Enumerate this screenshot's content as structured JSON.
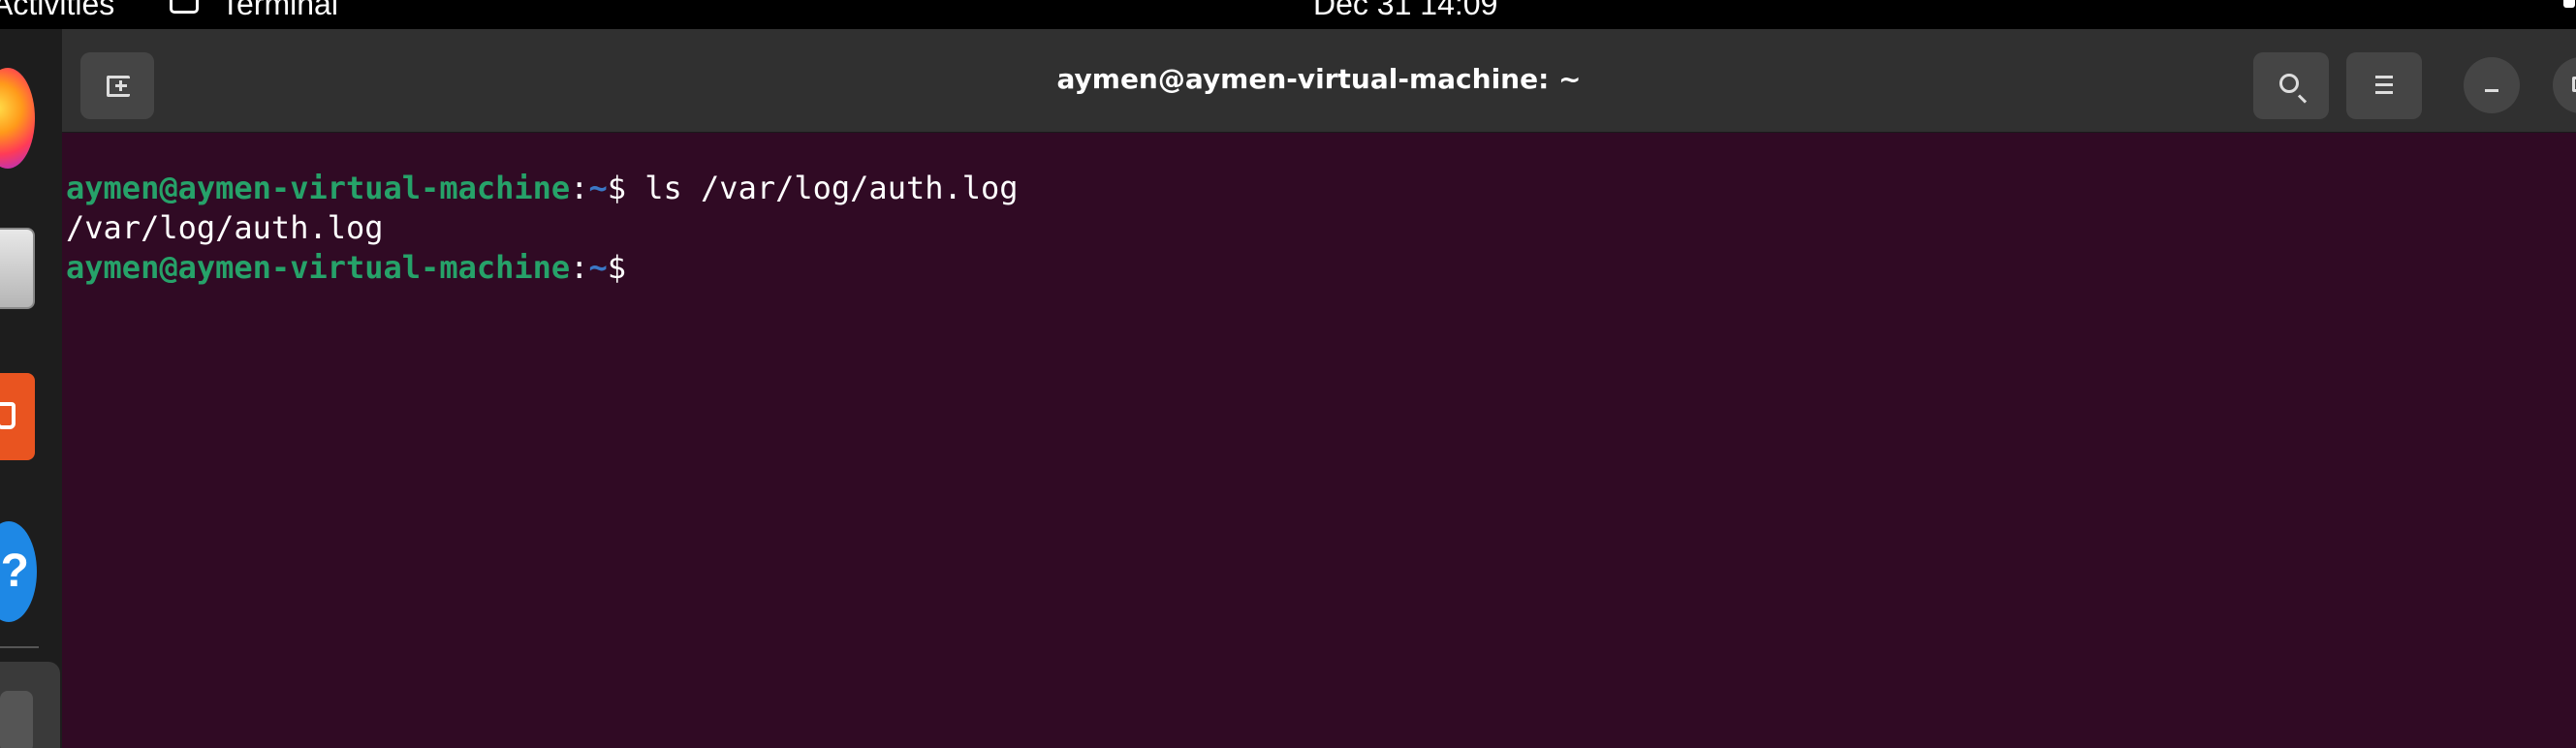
{
  "topbar": {
    "activities_label": "Activities",
    "app_name": "Terminal",
    "clock": "Dec 31  14:09"
  },
  "dock": {
    "items": [
      {
        "name": "Firefox",
        "icon": "firefox-icon"
      },
      {
        "name": "Files",
        "icon": "files-icon"
      },
      {
        "name": "Ubuntu Software",
        "icon": "software-store-icon"
      },
      {
        "name": "Help",
        "icon": "help-icon",
        "glyph": "?"
      },
      {
        "name": "Terminal",
        "icon": "terminal-icon"
      }
    ]
  },
  "window": {
    "title": "aymen@aymen-virtual-machine: ~",
    "buttons": {
      "new_tab": "new-tab-icon",
      "search": "search-icon",
      "menu": "hamburger-menu-icon",
      "minimize": "minimize-icon",
      "maximize": "maximize-icon"
    }
  },
  "terminal": {
    "colors": {
      "background": "#300a24",
      "prompt_user": "#26a269",
      "prompt_path": "#3b78c6",
      "text": "#ffffff"
    },
    "lines": [
      {
        "user_host": "aymen@aymen-virtual-machine",
        "sep": ":",
        "path": "~",
        "dollar": "$",
        "command": " ls /var/log/auth.log"
      },
      {
        "output": "/var/log/auth.log"
      },
      {
        "user_host": "aymen@aymen-virtual-machine",
        "sep": ":",
        "path": "~",
        "dollar": "$",
        "command": " "
      }
    ]
  }
}
